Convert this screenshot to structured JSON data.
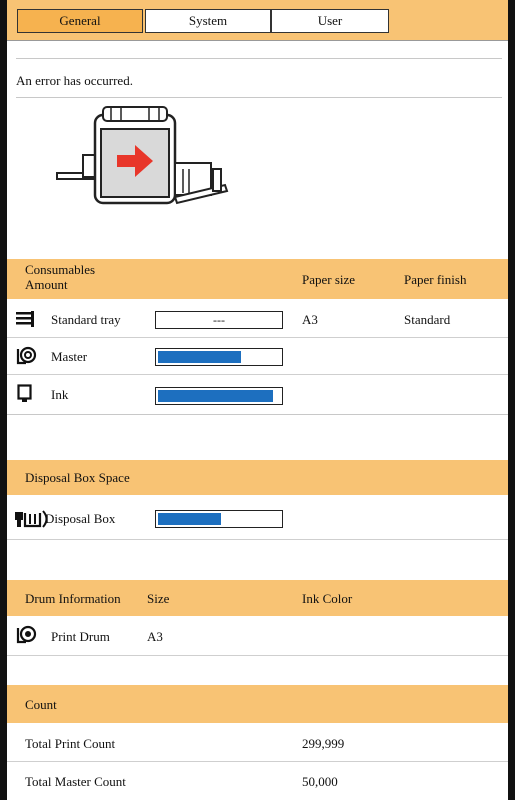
{
  "tabs": [
    {
      "label": "General",
      "active": true
    },
    {
      "label": "System",
      "active": false
    },
    {
      "label": "User",
      "active": false
    }
  ],
  "status_message": "An error has occurred.",
  "consumables": {
    "header": {
      "label": "Consumables\nAmount",
      "paper_size": "Paper size",
      "paper_finish": "Paper finish"
    },
    "rows": [
      {
        "icon": "tray-icon",
        "label": "Standard tray",
        "bar_text": "---",
        "level": 0,
        "paper_size": "A3",
        "paper_finish": "Standard"
      },
      {
        "icon": "master-roll-icon",
        "label": "Master",
        "level": 0.68
      },
      {
        "icon": "ink-cartridge-icon",
        "label": "Ink",
        "level": 0.94
      }
    ]
  },
  "disposal": {
    "header": "Disposal Box Space",
    "label": "Disposal Box",
    "icon": "disposal-box-icon",
    "level": 0.52
  },
  "drum": {
    "header": {
      "label": "Drum Information",
      "size": "Size",
      "ink_color": "Ink Color"
    },
    "label": "Print Drum",
    "icon": "print-drum-icon",
    "size": "A3",
    "ink_color": ""
  },
  "count": {
    "header": "Count",
    "rows": [
      {
        "label": "Total Print Count",
        "value": "299,999"
      },
      {
        "label": "Total Master Count",
        "value": "50,000"
      }
    ]
  },
  "colors": {
    "header_band": "#f8c374",
    "active_tab": "#f6b24f",
    "level_fill": "#1d6fbf",
    "arrow": "#e8362a"
  }
}
